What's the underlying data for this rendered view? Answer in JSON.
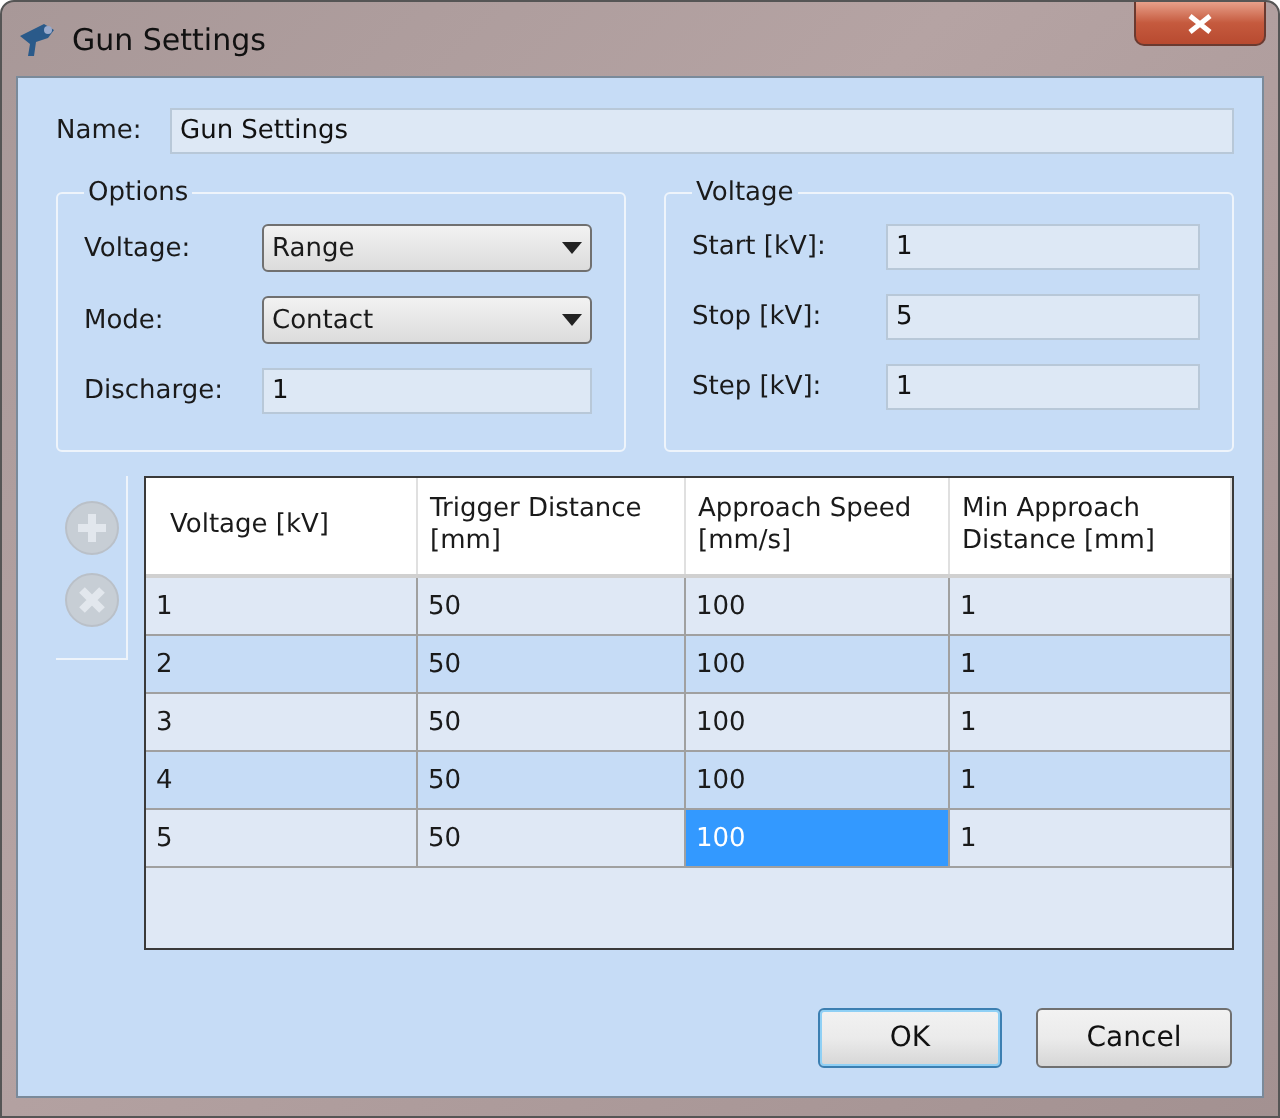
{
  "window": {
    "title": "Gun Settings"
  },
  "name": {
    "label": "Name:",
    "value": "Gun Settings"
  },
  "options": {
    "title": "Options",
    "fields": [
      {
        "kind": "dropdown",
        "label": "Voltage:",
        "value": "Range"
      },
      {
        "kind": "dropdown",
        "label": "Mode:",
        "value": "Contact"
      },
      {
        "kind": "text",
        "label": "Discharge:",
        "value": "1"
      }
    ]
  },
  "voltage": {
    "title": "Voltage",
    "fields": [
      {
        "kind": "text",
        "label": "Start [kV]:",
        "value": "1"
      },
      {
        "kind": "text",
        "label": "Stop [kV]:",
        "value": "5"
      },
      {
        "kind": "text",
        "label": "Step [kV]:",
        "value": "1"
      }
    ]
  },
  "toolbar": [
    {
      "kind": "add",
      "disabled": true
    },
    {
      "kind": "remove",
      "disabled": true
    }
  ],
  "table": {
    "columns": [
      "Voltage [kV]",
      "Trigger Distance [mm]",
      "Approach Speed [mm/s]",
      "Min Approach Distance [mm]"
    ],
    "rows": [
      [
        {
          "text": "1",
          "selected": false
        },
        {
          "text": "50",
          "selected": false
        },
        {
          "text": "100",
          "selected": false
        },
        {
          "text": "1",
          "selected": false
        }
      ],
      [
        {
          "text": "2",
          "selected": false
        },
        {
          "text": "50",
          "selected": false
        },
        {
          "text": "100",
          "selected": false
        },
        {
          "text": "1",
          "selected": false
        }
      ],
      [
        {
          "text": "3",
          "selected": false
        },
        {
          "text": "50",
          "selected": false
        },
        {
          "text": "100",
          "selected": false
        },
        {
          "text": "1",
          "selected": false
        }
      ],
      [
        {
          "text": "4",
          "selected": false
        },
        {
          "text": "50",
          "selected": false
        },
        {
          "text": "100",
          "selected": false
        },
        {
          "text": "1",
          "selected": false
        }
      ],
      [
        {
          "text": "5",
          "selected": false
        },
        {
          "text": "50",
          "selected": false
        },
        {
          "text": "100",
          "selected": true
        },
        {
          "text": "1",
          "selected": false
        }
      ]
    ]
  },
  "buttons": [
    {
      "label": "OK",
      "default": true
    },
    {
      "label": "Cancel",
      "default": false
    }
  ]
}
